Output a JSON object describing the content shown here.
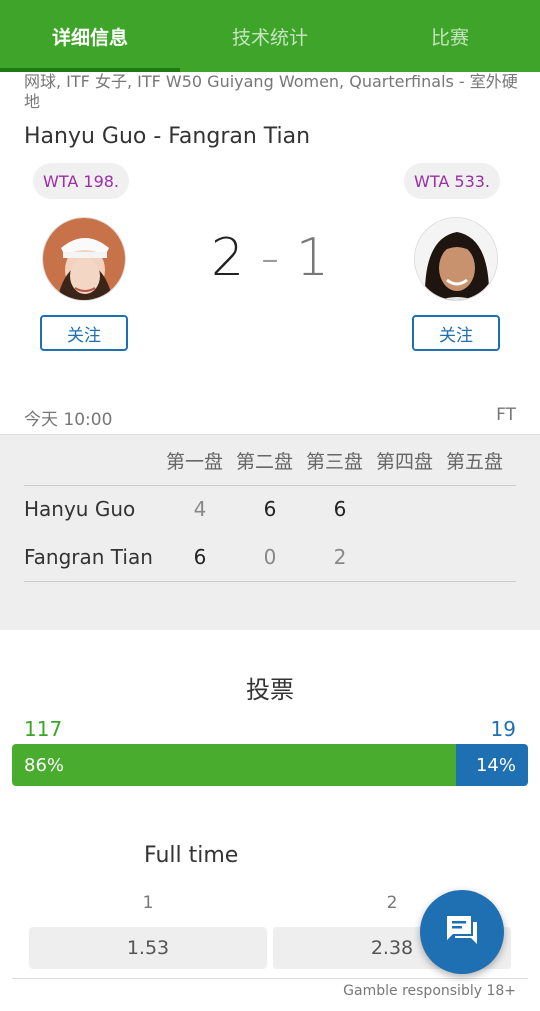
{
  "tabs": [
    {
      "label": "详细信息",
      "active": true
    },
    {
      "label": "技术统计",
      "active": false
    },
    {
      "label": "比赛",
      "active": false
    }
  ],
  "match": {
    "meta": "网球, ITF 女子, ITF W50 Guiyang Women, Quarterfinals - 室外硬地",
    "title": "Hanyu Guo - Fangran Tian",
    "home": {
      "rank": "WTA 198.",
      "name": "Hanyu Guo",
      "follow": "关注"
    },
    "away": {
      "rank": "WTA 533.",
      "name": "Fangran Tian",
      "follow": "关注"
    },
    "score_home": "2",
    "score_sep": "-",
    "score_away": "1",
    "time": "今天 10:00",
    "status": "FT"
  },
  "sets": {
    "headers": [
      "第一盘",
      "第二盘",
      "第三盘",
      "第四盘",
      "第五盘"
    ],
    "rows": [
      {
        "name": "Hanyu Guo",
        "scores": [
          "4",
          "6",
          "6"
        ]
      },
      {
        "name": "Fangran Tian",
        "scores": [
          "6",
          "0",
          "2"
        ]
      }
    ]
  },
  "vote": {
    "title": "投票",
    "home_count": "117",
    "away_count": "19",
    "home_pct": "86%",
    "away_pct": "14%",
    "home_fraction": 0.86
  },
  "odds": {
    "title": "Full time",
    "label_1": "1",
    "label_2": "2",
    "value_1": "1.53",
    "value_2": "2.38",
    "disclaimer": "Gamble responsibly 18+"
  },
  "colors": {
    "brand_green": "#3fa52a",
    "brand_blue": "#1f6fb3",
    "rank_purple": "#9b2fa6"
  },
  "icons": {
    "fab": "chat-icon"
  }
}
